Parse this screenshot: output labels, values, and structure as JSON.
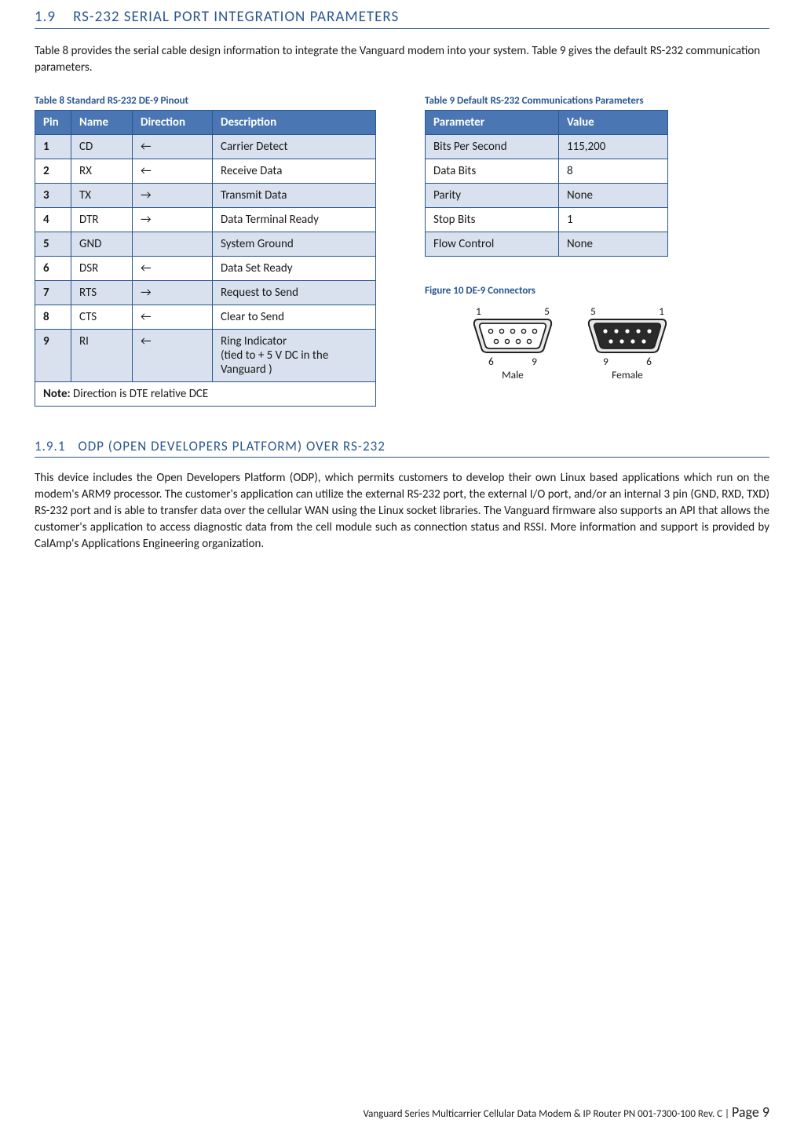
{
  "section": {
    "num": "1.9",
    "title": "RS-232 SERIAL PORT INTEGRATION PARAMETERS"
  },
  "intro": "Table 8 provides the serial cable design information to integrate the Vanguard modem into your system. Table 9 gives the default RS-232 communication parameters.",
  "table8": {
    "caption": "Table 8 Standard RS-232 DE-9 Pinout",
    "headers": {
      "pin": "Pin",
      "name": "Name",
      "direction": "Direction",
      "description": "Description"
    },
    "rows": [
      {
        "pin": "1",
        "name": "CD",
        "direction": "←",
        "description": "Carrier Detect"
      },
      {
        "pin": "2",
        "name": "RX",
        "direction": "←",
        "description": "Receive Data"
      },
      {
        "pin": "3",
        "name": "TX",
        "direction": "→",
        "description": "Transmit Data"
      },
      {
        "pin": "4",
        "name": "DTR",
        "direction": "→",
        "description": "Data Terminal Ready"
      },
      {
        "pin": "5",
        "name": "GND",
        "direction": "",
        "description": "System Ground"
      },
      {
        "pin": "6",
        "name": "DSR",
        "direction": "←",
        "description": "Data Set Ready"
      },
      {
        "pin": "7",
        "name": "RTS",
        "direction": "→",
        "description": "Request to Send"
      },
      {
        "pin": "8",
        "name": "CTS",
        "direction": "←",
        "description": "Clear to Send"
      },
      {
        "pin": "9",
        "name": "RI",
        "direction": "←",
        "description": "Ring Indicator\n(tied to + 5 V DC in the Vanguard )"
      }
    ],
    "note_label": "Note:",
    "note_text": " Direction is DTE relative DCE"
  },
  "table9": {
    "caption": "Table 9 Default RS-232 Communications Parameters",
    "headers": {
      "parameter": "Parameter",
      "value": "Value"
    },
    "rows": [
      {
        "parameter": "Bits Per Second",
        "value": "115,200"
      },
      {
        "parameter": "Data Bits",
        "value": "8"
      },
      {
        "parameter": "Parity",
        "value": "None"
      },
      {
        "parameter": "Stop Bits",
        "value": "1"
      },
      {
        "parameter": "Flow Control",
        "value": "None"
      }
    ]
  },
  "figure": {
    "caption": "Figure 10 DE-9 Connectors",
    "male": {
      "tl": "1",
      "tr": "5",
      "bl": "6",
      "br": "9",
      "label": "Male"
    },
    "female": {
      "tl": "5",
      "tr": "1",
      "bl": "9",
      "br": "6",
      "label": "Female"
    }
  },
  "subsection": {
    "num": "1.9.1",
    "title": "ODP (OPEN DEVELOPERS PLATFORM) OVER RS-232"
  },
  "body": "This device includes the Open Developers Platform (ODP), which permits customers to develop their own Linux based applications which run on the modem's ARM9 processor. The customer's application can utilize the external RS-232 port, the external I/O port, and/or an internal 3 pin (GND, RXD, TXD) RS-232 port and is able to transfer data over the cellular WAN using the Linux socket libraries. The Vanguard firmware also supports an API that allows the customer's application to access diagnostic data from the cell module such as connection status and RSSI. More information and support is provided by CalAmp's Applications Engineering organization.",
  "footer": {
    "text": "Vanguard Series Multicarrier Cellular Data Modem & IP Router PN 001-7300-100 Rev. C",
    "sep": " | ",
    "page_label": "Page 9"
  }
}
